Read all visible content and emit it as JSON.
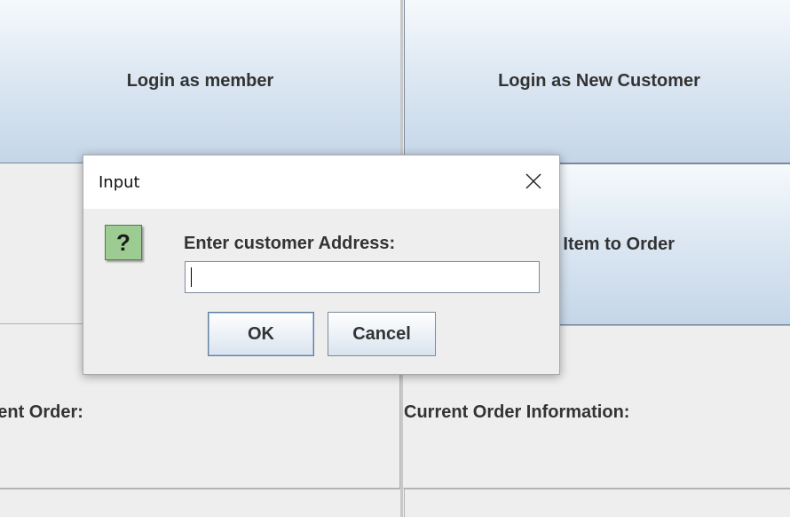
{
  "main": {
    "login_member_label": "Login as member",
    "login_new_customer_label": "Login as New Customer",
    "add_item_label": "Add Item to Order",
    "current_order_label": "Current Order:",
    "current_order_info_label": "Current Order Information:"
  },
  "dialog": {
    "title": "Input",
    "prompt": "Enter customer Address:",
    "input_value": "",
    "ok_label": "OK",
    "cancel_label": "Cancel",
    "icon": "question-icon",
    "close_icon": "close-icon"
  },
  "colors": {
    "button_gradient_top": "#f6f9fc",
    "button_gradient_bottom": "#c5d6e8",
    "question_icon_bg": "#9ccc92",
    "panel_bg": "#eeeeee"
  }
}
